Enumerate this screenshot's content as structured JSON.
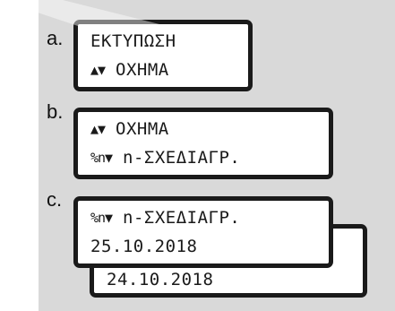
{
  "steps": {
    "a": {
      "label": "a.",
      "lines": [
        {
          "icon": "",
          "text": "ΕΚΤΥΠΩΣΗ"
        },
        {
          "icon": "▲▼",
          "text": " ΟΧΗΜΑ"
        }
      ]
    },
    "b": {
      "label": "b.",
      "lines": [
        {
          "icon": "▲▼",
          "text": " ΟΧΗΜΑ"
        },
        {
          "icon": "%n▼",
          "text": " n-ΣΧΕΔΙΑΓΡ."
        }
      ]
    },
    "c": {
      "label": "c.",
      "lines": [
        {
          "icon": "%n▼",
          "text": " n-ΣΧΕΔΙΑΓΡ."
        },
        {
          "icon": "",
          "text": "25.10.2018"
        }
      ],
      "back_line": "24.10.2018"
    }
  },
  "colors": {
    "panel": "#d9d9d9",
    "frame": "#1a1a1a",
    "screen": "#ffffff"
  }
}
